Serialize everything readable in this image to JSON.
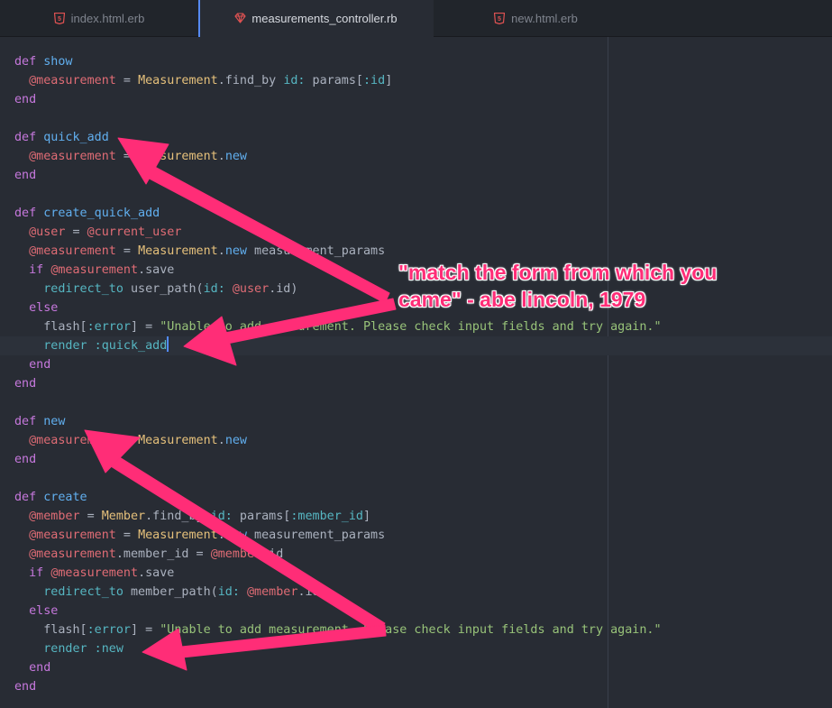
{
  "tabs": [
    {
      "label": "index.html.erb",
      "icon": "html5-icon",
      "active": false
    },
    {
      "label": "measurements_controller.rb",
      "icon": "ruby-gem-icon",
      "active": true
    },
    {
      "label": "new.html.erb",
      "icon": "html5-icon",
      "active": false
    }
  ],
  "code_lines": [
    [
      {
        "t": "kw",
        "v": "def "
      },
      {
        "t": "fn",
        "v": "show"
      }
    ],
    [
      {
        "t": "pl",
        "v": "  "
      },
      {
        "t": "ivar",
        "v": "@measurement"
      },
      {
        "t": "pl",
        "v": " = "
      },
      {
        "t": "const",
        "v": "Measurement"
      },
      {
        "t": "pl",
        "v": ".find_by "
      },
      {
        "t": "sym",
        "v": "id:"
      },
      {
        "t": "pl",
        "v": " params["
      },
      {
        "t": "sym",
        "v": ":id"
      },
      {
        "t": "pl",
        "v": "]"
      }
    ],
    [
      {
        "t": "kw",
        "v": "end"
      }
    ],
    [],
    [
      {
        "t": "kw",
        "v": "def "
      },
      {
        "t": "fn",
        "v": "quick_add"
      }
    ],
    [
      {
        "t": "pl",
        "v": "  "
      },
      {
        "t": "ivar",
        "v": "@measurement"
      },
      {
        "t": "pl",
        "v": " = "
      },
      {
        "t": "const",
        "v": "Measurement"
      },
      {
        "t": "pl",
        "v": "."
      },
      {
        "t": "fn",
        "v": "new"
      }
    ],
    [
      {
        "t": "kw",
        "v": "end"
      }
    ],
    [],
    [
      {
        "t": "kw",
        "v": "def "
      },
      {
        "t": "fn",
        "v": "create_quick_add"
      }
    ],
    [
      {
        "t": "pl",
        "v": "  "
      },
      {
        "t": "ivar",
        "v": "@user"
      },
      {
        "t": "pl",
        "v": " = "
      },
      {
        "t": "ivar",
        "v": "@current_user"
      }
    ],
    [
      {
        "t": "pl",
        "v": "  "
      },
      {
        "t": "ivar",
        "v": "@measurement"
      },
      {
        "t": "pl",
        "v": " = "
      },
      {
        "t": "const",
        "v": "Measurement"
      },
      {
        "t": "pl",
        "v": "."
      },
      {
        "t": "fn",
        "v": "new"
      },
      {
        "t": "pl",
        "v": " measurement_params"
      }
    ],
    [
      {
        "t": "pl",
        "v": "  "
      },
      {
        "t": "kw",
        "v": "if "
      },
      {
        "t": "ivar",
        "v": "@measurement"
      },
      {
        "t": "pl",
        "v": ".save"
      }
    ],
    [
      {
        "t": "pl",
        "v": "    "
      },
      {
        "t": "sym",
        "v": "redirect_to"
      },
      {
        "t": "pl",
        "v": " user_path("
      },
      {
        "t": "sym",
        "v": "id:"
      },
      {
        "t": "pl",
        "v": " "
      },
      {
        "t": "ivar",
        "v": "@user"
      },
      {
        "t": "pl",
        "v": ".id)"
      }
    ],
    [
      {
        "t": "pl",
        "v": "  "
      },
      {
        "t": "kw",
        "v": "else"
      }
    ],
    [
      {
        "t": "pl",
        "v": "    flash["
      },
      {
        "t": "sym",
        "v": ":error"
      },
      {
        "t": "pl",
        "v": "] = "
      },
      {
        "t": "str",
        "v": "\"Unable to add measurement. Please check input fields and try again.\""
      }
    ],
    [
      {
        "t": "pl",
        "v": "    "
      },
      {
        "t": "sym",
        "v": "render :quick_add"
      },
      {
        "t": "cursor",
        "v": ""
      }
    ],
    [
      {
        "t": "pl",
        "v": "  "
      },
      {
        "t": "kw",
        "v": "end"
      }
    ],
    [
      {
        "t": "kw",
        "v": "end"
      }
    ],
    [],
    [
      {
        "t": "kw",
        "v": "def "
      },
      {
        "t": "fn",
        "v": "new"
      }
    ],
    [
      {
        "t": "pl",
        "v": "  "
      },
      {
        "t": "ivar",
        "v": "@measurement"
      },
      {
        "t": "pl",
        "v": " = "
      },
      {
        "t": "const",
        "v": "Measurement"
      },
      {
        "t": "pl",
        "v": "."
      },
      {
        "t": "fn",
        "v": "new"
      }
    ],
    [
      {
        "t": "kw",
        "v": "end"
      }
    ],
    [],
    [
      {
        "t": "kw",
        "v": "def "
      },
      {
        "t": "fn",
        "v": "create"
      }
    ],
    [
      {
        "t": "pl",
        "v": "  "
      },
      {
        "t": "ivar",
        "v": "@member"
      },
      {
        "t": "pl",
        "v": " = "
      },
      {
        "t": "const",
        "v": "Member"
      },
      {
        "t": "pl",
        "v": ".find_by "
      },
      {
        "t": "sym",
        "v": "id:"
      },
      {
        "t": "pl",
        "v": " params["
      },
      {
        "t": "sym",
        "v": ":member_id"
      },
      {
        "t": "pl",
        "v": "]"
      }
    ],
    [
      {
        "t": "pl",
        "v": "  "
      },
      {
        "t": "ivar",
        "v": "@measurement"
      },
      {
        "t": "pl",
        "v": " = "
      },
      {
        "t": "const",
        "v": "Measurement"
      },
      {
        "t": "pl",
        "v": "."
      },
      {
        "t": "fn",
        "v": "new"
      },
      {
        "t": "pl",
        "v": " measurement_params"
      }
    ],
    [
      {
        "t": "pl",
        "v": "  "
      },
      {
        "t": "ivar",
        "v": "@measurement"
      },
      {
        "t": "pl",
        "v": ".member_id = "
      },
      {
        "t": "ivar",
        "v": "@member"
      },
      {
        "t": "pl",
        "v": ".id"
      }
    ],
    [
      {
        "t": "pl",
        "v": "  "
      },
      {
        "t": "kw",
        "v": "if "
      },
      {
        "t": "ivar",
        "v": "@measurement"
      },
      {
        "t": "pl",
        "v": ".save"
      }
    ],
    [
      {
        "t": "pl",
        "v": "    "
      },
      {
        "t": "sym",
        "v": "redirect_to"
      },
      {
        "t": "pl",
        "v": " member_path("
      },
      {
        "t": "sym",
        "v": "id:"
      },
      {
        "t": "pl",
        "v": " "
      },
      {
        "t": "ivar",
        "v": "@member"
      },
      {
        "t": "pl",
        "v": ".id)"
      }
    ],
    [
      {
        "t": "pl",
        "v": "  "
      },
      {
        "t": "kw",
        "v": "else"
      }
    ],
    [
      {
        "t": "pl",
        "v": "    flash["
      },
      {
        "t": "sym",
        "v": ":error"
      },
      {
        "t": "pl",
        "v": "] = "
      },
      {
        "t": "str",
        "v": "\"Unable to add measurement. Please check input fields and try again.\""
      }
    ],
    [
      {
        "t": "pl",
        "v": "    "
      },
      {
        "t": "sym",
        "v": "render :new"
      }
    ],
    [
      {
        "t": "pl",
        "v": "  "
      },
      {
        "t": "kw",
        "v": "end"
      }
    ],
    [
      {
        "t": "kw",
        "v": "end"
      }
    ]
  ],
  "annotation": {
    "text": "\"match the form from which you came\" - abe lincoln, 1979",
    "color": "#ff2d77"
  },
  "colors": {
    "background": "#282c34",
    "tab_bar": "#21252b",
    "keyword": "#c678dd",
    "function": "#61afef",
    "instance_var": "#e06c75",
    "constant": "#e5c07b",
    "symbol": "#56b6c2",
    "string": "#98c379",
    "plain": "#abb2bf",
    "cursor": "#528bff"
  }
}
